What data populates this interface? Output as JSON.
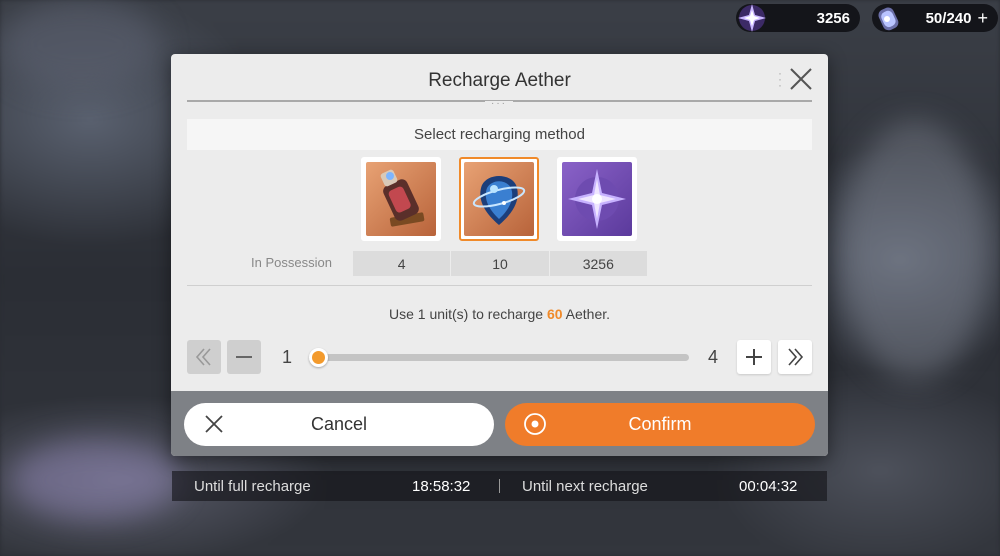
{
  "resources": {
    "crystal_amount": "3256",
    "aether_amount": "50/240",
    "add_symbol": "+"
  },
  "dialog": {
    "title": "Recharge Aether",
    "method_header": "Select recharging method",
    "items": [
      {
        "icon": "potion-bottle-icon",
        "possession": "4",
        "selected": false
      },
      {
        "icon": "aether-orb-icon",
        "possession": "10",
        "selected": true
      },
      {
        "icon": "crystal-star-icon",
        "possession": "3256",
        "selected": false
      }
    ],
    "possession_label": "In Possession",
    "use_text_prefix": "Use 1 unit(s) to recharge ",
    "use_amount": "60",
    "use_text_suffix": " Aether.",
    "slider": {
      "min": "1",
      "max": "4",
      "value": 1
    },
    "cancel_label": "Cancel",
    "confirm_label": "Confirm"
  },
  "timers": {
    "full_label": "Until full recharge",
    "full_value": "18:58:32",
    "next_label": "Until next recharge",
    "next_value": "00:04:32"
  },
  "colors": {
    "accent": "#f07c2a",
    "slider_thumb": "#f39a2c"
  }
}
